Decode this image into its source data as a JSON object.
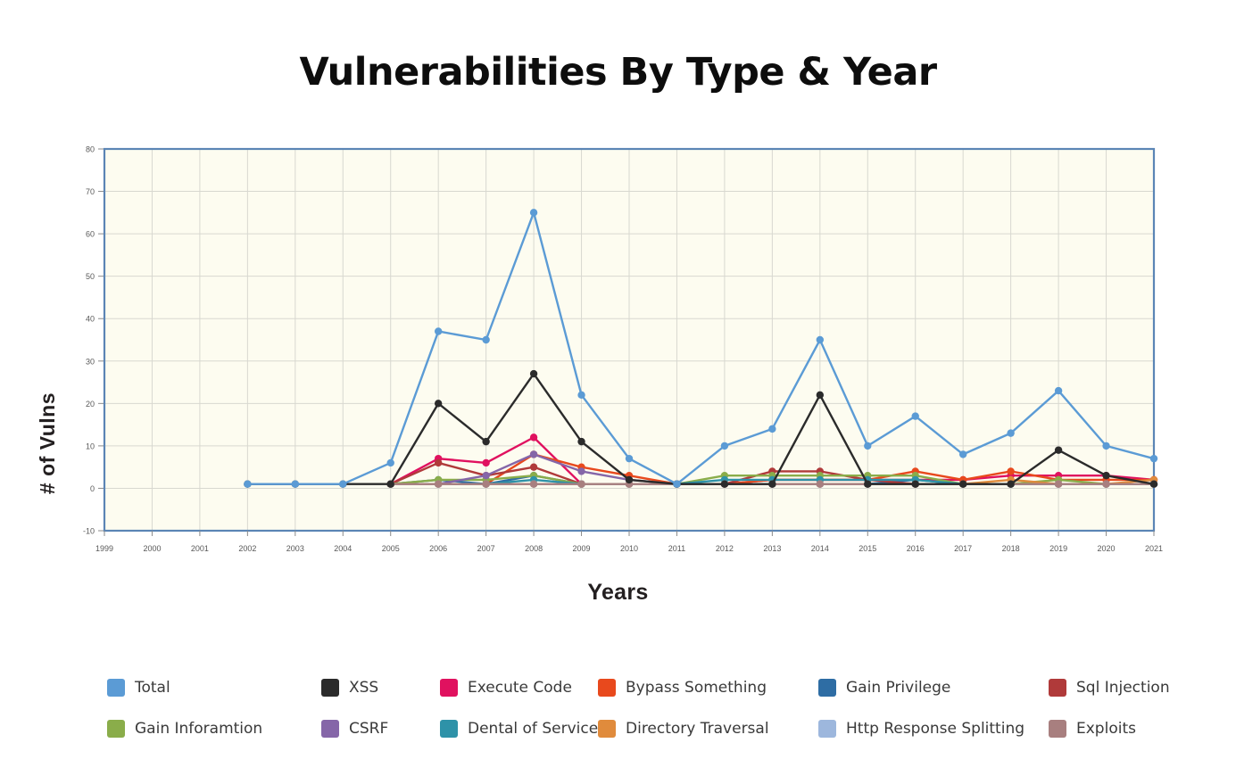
{
  "chart_data": {
    "type": "line",
    "title": "Vulnerabilities By Type & Year",
    "xlabel": "Years",
    "ylabel": "# of Vulns",
    "ylim": [
      -10,
      80
    ],
    "yticks": [
      -10,
      0,
      10,
      20,
      30,
      40,
      50,
      60,
      70,
      80
    ],
    "grid": true,
    "legend_position": "bottom",
    "categories": [
      1999,
      2000,
      2001,
      2002,
      2003,
      2004,
      2005,
      2006,
      2007,
      2008,
      2009,
      2010,
      2011,
      2012,
      2013,
      2014,
      2015,
      2016,
      2017,
      2018,
      2019,
      2020,
      2021
    ],
    "x": [
      "1999",
      "2000",
      "2001",
      "2002",
      "2003",
      "2004",
      "2005",
      "2006",
      "2007",
      "2008",
      "2009",
      "2010",
      "2011",
      "2012",
      "2013",
      "2014",
      "2015",
      "2016",
      "2017",
      "2018",
      "2019",
      "2020",
      "2021"
    ],
    "series": [
      {
        "name": "Total",
        "color": "#5b9bd5",
        "start_index": 3,
        "values": [
          1,
          1,
          1,
          6,
          37,
          35,
          65,
          22,
          7,
          1,
          10,
          14,
          35,
          10,
          17,
          8,
          13,
          23,
          10,
          7
        ]
      },
      {
        "name": "XSS",
        "color": "#2b2b2b",
        "start_index": 3,
        "values": [
          1,
          1,
          1,
          1,
          20,
          11,
          27,
          11,
          2,
          1,
          1,
          1,
          22,
          1,
          1,
          1,
          1,
          9,
          3,
          1
        ]
      },
      {
        "name": "Execute Code",
        "color": "#e0115f",
        "start_index": 6,
        "values": [
          1,
          7,
          6,
          12,
          1,
          1,
          1,
          1,
          2,
          2,
          2,
          2,
          2,
          3,
          3,
          3,
          2
        ]
      },
      {
        "name": "Bypass Something",
        "color": "#e8491d",
        "start_index": 6,
        "values": [
          1,
          1,
          1,
          8,
          5,
          3,
          1,
          1,
          2,
          2,
          2,
          4,
          2,
          4,
          2,
          2,
          2
        ]
      },
      {
        "name": "Gain Privilege",
        "color": "#2e6da4",
        "start_index": 6,
        "values": [
          1,
          2,
          1,
          3,
          1,
          1,
          1,
          1,
          1,
          1,
          1,
          2,
          1,
          1,
          1,
          1,
          1
        ]
      },
      {
        "name": "Sql Injection",
        "color": "#b03a3a",
        "start_index": 6,
        "values": [
          1,
          6,
          3,
          5,
          1,
          1,
          1,
          1,
          4,
          4,
          2,
          1,
          1,
          1,
          1,
          1,
          1
        ]
      },
      {
        "name": "Gain Inforamtion",
        "color": "#8aad4a",
        "start_index": 6,
        "values": [
          1,
          2,
          2,
          3,
          1,
          1,
          1,
          3,
          3,
          3,
          3,
          3,
          1,
          1,
          2,
          1,
          1
        ]
      },
      {
        "name": "CSRF",
        "color": "#8566a8",
        "start_index": 6,
        "values": [
          1,
          1,
          3,
          8,
          4,
          2,
          1,
          1,
          1,
          1,
          1,
          1,
          1,
          1,
          1,
          1,
          1
        ]
      },
      {
        "name": "Dental of Service",
        "color": "#2e92a8",
        "start_index": 6,
        "values": [
          1,
          1,
          1,
          2,
          1,
          1,
          1,
          2,
          2,
          2,
          2,
          2,
          1,
          1,
          1,
          1,
          1
        ]
      },
      {
        "name": "Directory Traversal",
        "color": "#e08b3c",
        "start_index": 6,
        "values": [
          1,
          1,
          1,
          1,
          1,
          1,
          1,
          1,
          1,
          1,
          1,
          1,
          1,
          2,
          1,
          1,
          2
        ]
      },
      {
        "name": "Http Response Splitting",
        "color": "#9db7dd",
        "start_index": 6,
        "values": [
          1,
          1,
          1,
          1,
          1,
          1,
          1,
          1,
          1,
          1,
          1,
          1,
          1,
          1,
          1,
          1,
          1
        ]
      },
      {
        "name": "Exploits",
        "color": "#a87f7f",
        "start_index": 6,
        "values": [
          1,
          1,
          1,
          1,
          1,
          1,
          1,
          1,
          1,
          1,
          1,
          1,
          1,
          1,
          1,
          1,
          1
        ]
      }
    ]
  },
  "legend": {
    "rows": [
      [
        {
          "label": "Total",
          "color": "#5b9bd5"
        },
        {
          "label": "XSS",
          "color": "#2b2b2b"
        },
        {
          "label": "Execute Code",
          "color": "#e0115f"
        },
        {
          "label": "Bypass Something",
          "color": "#e8491d"
        },
        {
          "label": "Gain Privilege",
          "color": "#2e6da4"
        },
        {
          "label": "Sql Injection",
          "color": "#b03a3a"
        }
      ],
      [
        {
          "label": "Gain Inforamtion",
          "color": "#8aad4a"
        },
        {
          "label": "CSRF",
          "color": "#8566a8"
        },
        {
          "label": "Dental of Service",
          "color": "#2e92a8"
        },
        {
          "label": "Directory Traversal",
          "color": "#e08b3c"
        },
        {
          "label": "Http Response Splitting",
          "color": "#9db7dd"
        },
        {
          "label": "Exploits",
          "color": "#a87f7f"
        }
      ]
    ]
  },
  "style": {
    "plot_background": "#fdfcf0",
    "plot_border": "#5b85b5",
    "grid_color": "#d8d8d0"
  }
}
